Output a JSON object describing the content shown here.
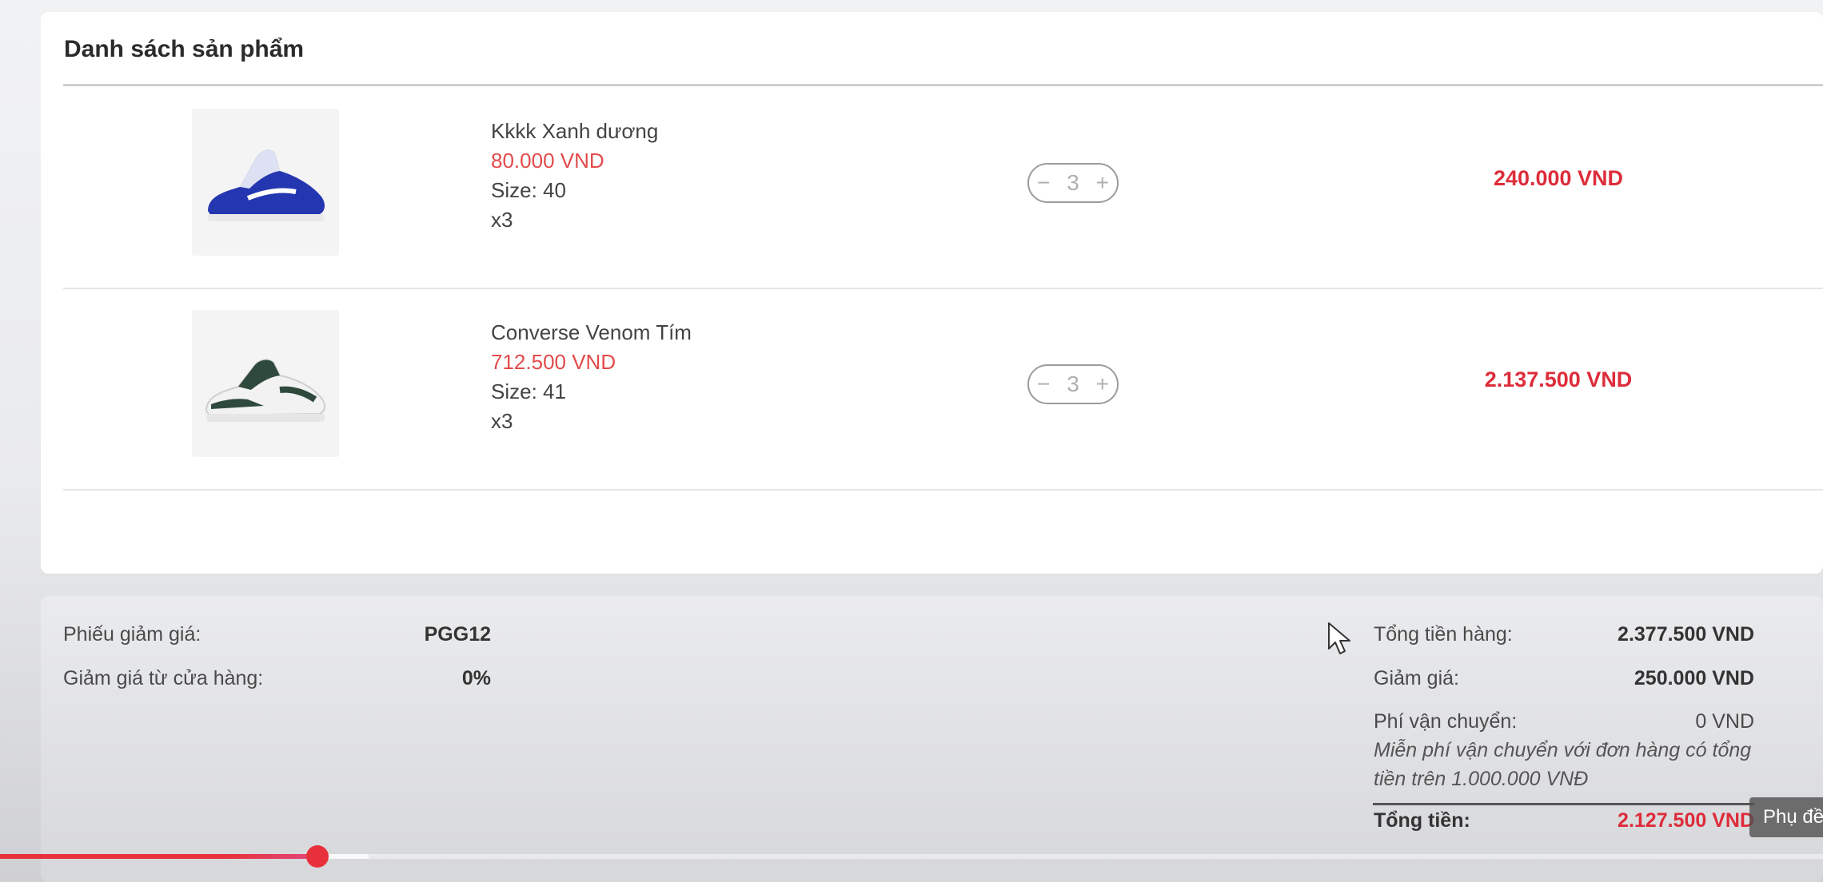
{
  "products_card": {
    "title": "Danh sách sản phẩm",
    "items": [
      {
        "name": "Kkkk Xanh dương",
        "unit_price": "80.000 VND",
        "size": "Size: 40",
        "qty_label": "x3",
        "qty": "3",
        "line_total": "240.000 VND",
        "shoe_color": "#2436b0"
      },
      {
        "name": "Converse Venom Tím",
        "unit_price": "712.500 VND",
        "size": "Size: 41",
        "qty_label": "x3",
        "qty": "3",
        "line_total": "2.137.500 VND",
        "shoe_color": "#2f4a3c"
      }
    ],
    "stepper": {
      "minus": "−",
      "plus": "+"
    }
  },
  "summary": {
    "voucher_label": "Phiếu giảm giá:",
    "voucher_value": "PGG12",
    "store_discount_label": "Giảm giá từ cửa hàng:",
    "store_discount_value": "0%",
    "subtotal_label": "Tổng tiền hàng:",
    "subtotal_value": "2.377.500 VND",
    "discount_label": "Giảm giá:",
    "discount_value": "250.000 VND",
    "shipping_label": "Phí vận chuyển:",
    "shipping_value": "0 VND",
    "shipping_note": "Miễn phí vận chuyển với đơn hàng có tổng tiền trên 1.000.000 VNĐ",
    "total_label": "Tổng tiền:",
    "total_value": "2.127.500 VND"
  },
  "video_player": {
    "played_fraction": 0.174,
    "buffered_fraction": 0.202,
    "subtitle_button": "Phụ đề"
  },
  "colors": {
    "price_red": "#e24b4b",
    "total_red": "#dd2c3a",
    "progress_red": "#e8303a"
  }
}
